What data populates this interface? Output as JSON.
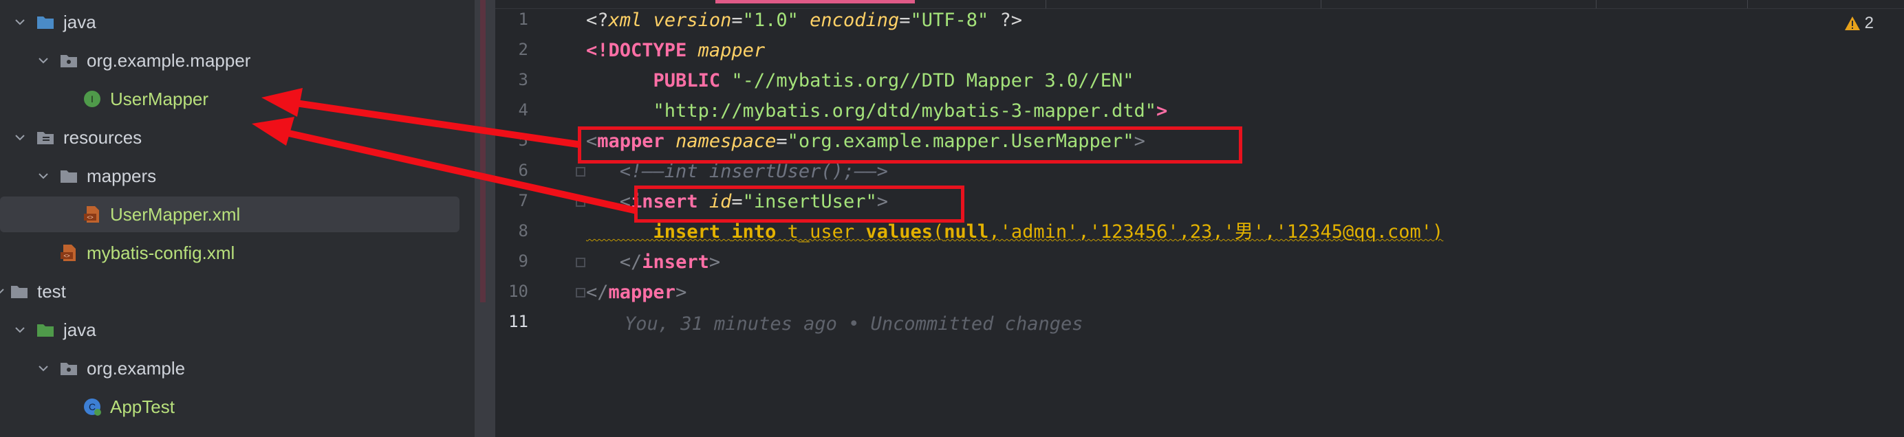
{
  "tree": {
    "items": [
      {
        "label": "java"
      },
      {
        "label": "org.example.mapper"
      },
      {
        "label": "UserMapper"
      },
      {
        "label": "resources"
      },
      {
        "label": "mappers"
      },
      {
        "label": "UserMapper.xml"
      },
      {
        "label": "mybatis-config.xml"
      },
      {
        "label": "test"
      },
      {
        "label": "java"
      },
      {
        "label": "org.example"
      },
      {
        "label": "AppTest"
      }
    ]
  },
  "editor": {
    "line_numbers": [
      "1",
      "2",
      "3",
      "4",
      "5",
      "6",
      "7",
      "8",
      "9",
      "10",
      "11"
    ],
    "warnings_count": "2",
    "lines": {
      "l1": {
        "open": "<?",
        "xml": "xml",
        "sp1": " ",
        "a1": "version",
        "eq1": "=",
        "v1": "\"1.0\"",
        "sp2": " ",
        "a2": "encoding",
        "eq2": "=",
        "v2": "\"UTF-8\"",
        "close": " ?>"
      },
      "l2": {
        "open": "<!DOCTYPE",
        "sp": " ",
        "name": "mapper"
      },
      "l3": {
        "indent": "      ",
        "pub": "PUBLIC",
        "sp": " ",
        "val": "\"-//mybatis.org//DTD Mapper 3.0//EN\""
      },
      "l4": {
        "indent": "      ",
        "val": "\"http://mybatis.org/dtd/mybatis-3-mapper.dtd\"",
        "close": ">"
      },
      "l5": {
        "lt": "<",
        "tag": "mapper",
        "sp": " ",
        "attr": "namespace",
        "eq": "=",
        "val": "\"org.example.mapper.UserMapper\"",
        "gt": ">"
      },
      "l6": {
        "indent": "   ",
        "comment": "<!——int insertUser();——>"
      },
      "l7": {
        "indent": "   ",
        "lt": "<",
        "tag": "insert",
        "sp": " ",
        "attr": "id",
        "eq": "=",
        "val": "\"insertUser\"",
        "gt": ">"
      },
      "l8": {
        "indent": "      ",
        "kw1": "insert",
        "sp1": " ",
        "kw2": "into",
        "sp2": " ",
        "table": "t_user",
        "sp3": " ",
        "kw3": "values",
        "open": "(",
        "kw4": "null",
        "rest": ",'admin','123456',23,'男','12345@qq.com')"
      },
      "l9": {
        "indent": "   ",
        "lt": "</",
        "tag": "insert",
        "gt": ">"
      },
      "l10": {
        "lt": "</",
        "tag": "mapper",
        "gt": ">"
      }
    },
    "blame": "You, 31 minutes ago • Uncommitted changes"
  },
  "colors": {
    "annotation_red": "#e8121e",
    "tag_pink": "#ff6fa6",
    "string_green": "#a4e27a",
    "attr_yellow": "#ffd166"
  },
  "icons": [
    "chevron-down-icon",
    "folder-icon",
    "package-folder-icon",
    "interface-icon",
    "resources-folder-icon",
    "xml-file-icon",
    "test-class-icon",
    "warning-icon"
  ]
}
